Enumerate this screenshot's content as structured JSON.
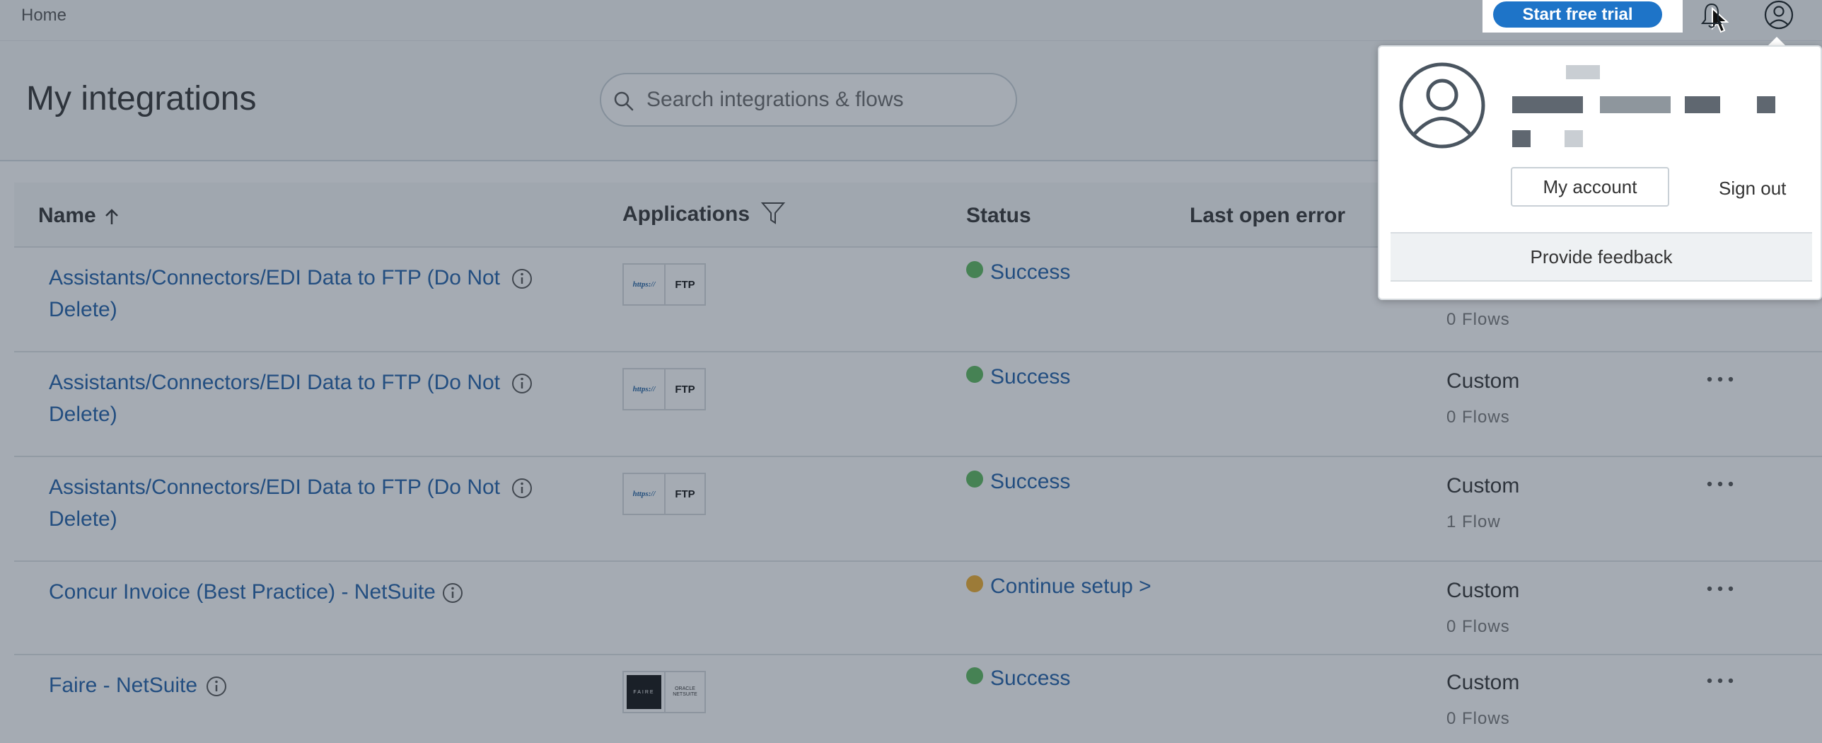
{
  "topbar": {
    "home_label": "Home",
    "trial_label": "Start free trial",
    "bell_icon": "bell-icon",
    "profile_icon": "user-circle-icon"
  },
  "header": {
    "title": "My integrations",
    "search_placeholder": "Search integrations & flows"
  },
  "table": {
    "columns": {
      "name": "Name",
      "applications": "Applications",
      "status": "Status",
      "last_open_error": "Last open error"
    },
    "rows": [
      {
        "name": "Assistants/Connectors/EDI Data to FTP (Do Not Delete)",
        "apps": [
          "https://",
          "FTP"
        ],
        "status": "Success",
        "status_color": "#5cb85c",
        "type": "",
        "flows": "0 Flows"
      },
      {
        "name": "Assistants/Connectors/EDI Data to FTP (Do Not Delete)",
        "apps": [
          "https://",
          "FTP"
        ],
        "status": "Success",
        "status_color": "#5cb85c",
        "type": "Custom",
        "flows": "0 Flows"
      },
      {
        "name": "Assistants/Connectors/EDI Data to FTP (Do Not Delete)",
        "apps": [
          "https://",
          "FTP"
        ],
        "status": "Success",
        "status_color": "#5cb85c",
        "type": "Custom",
        "flows": "1 Flow"
      },
      {
        "name": "Concur Invoice (Best Practice) - NetSuite",
        "apps": [],
        "status": "Continue setup >",
        "status_color": "#f0ad2b",
        "type": "Custom",
        "flows": "0 Flows"
      },
      {
        "name": "Faire - NetSuite",
        "apps": [
          "FAIRE",
          "ORACLE NETSUITE"
        ],
        "status": "Success",
        "status_color": "#5cb85c",
        "type": "Custom",
        "flows": "0 Flows"
      }
    ]
  },
  "profile_menu": {
    "my_account_label": "My account",
    "sign_out_label": "Sign out",
    "feedback_label": "Provide feedback"
  },
  "colors": {
    "primary": "#1e74c8",
    "link": "#1f5fa8",
    "success": "#5cb85c",
    "warning": "#f0ad2b"
  }
}
